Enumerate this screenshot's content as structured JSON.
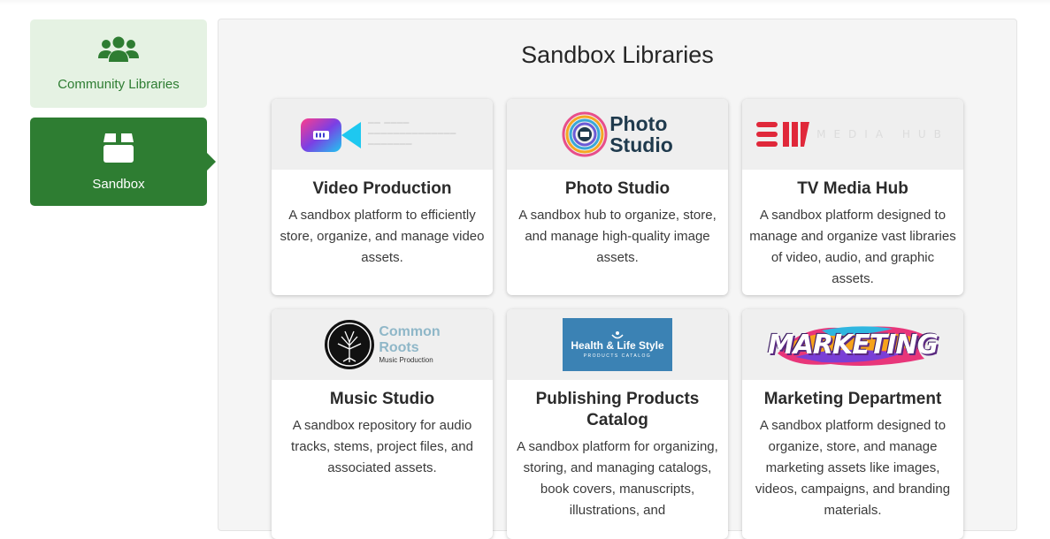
{
  "sidebar": {
    "items": [
      {
        "label": "Community Libraries",
        "icon": "users-icon",
        "active": false
      },
      {
        "label": "Sandbox",
        "icon": "box-icon",
        "active": true
      }
    ]
  },
  "main": {
    "title": "Sandbox Libraries",
    "cards": [
      {
        "title": "Video Production",
        "description": "A sandbox platform to efficiently store, organize, and manage video assets.",
        "logo": "video-camera-logo"
      },
      {
        "title": "Photo Studio",
        "description": "A sandbox hub to organize, store, and manage high-quality image assets.",
        "logo": "photo-studio-logo",
        "logo_text": [
          "Photo",
          "Studio"
        ]
      },
      {
        "title": "TV Media Hub",
        "description": "A sandbox platform designed to manage and organize vast libraries of video, audio, and graphic assets.",
        "logo": "media-hub-logo",
        "logo_text": "MEDIA HUB"
      },
      {
        "title": "Music Studio",
        "description": "A sandbox repository for audio tracks, stems, project files, and associated assets.",
        "logo": "common-roots-logo",
        "logo_text": [
          "Common",
          "Roots",
          "Music Production"
        ]
      },
      {
        "title": "Publishing Products Catalog",
        "description": "A sandbox platform for organizing, storing, and managing catalogs, book covers, manuscripts, illustrations, and",
        "logo": "health-life-style-logo",
        "logo_text": [
          "Health & Life Style",
          "PRODUCTS CATALOG"
        ]
      },
      {
        "title": "Marketing Department",
        "description": "A sandbox platform designed to organize, store, and manage marketing assets like images, videos, campaigns, and branding materials.",
        "logo": "marketing-logo",
        "logo_text": "MARKETING"
      }
    ]
  },
  "colors": {
    "accent": "#2e7d32",
    "accent_light": "#e5f2e3",
    "panel": "#f5f5f5"
  }
}
